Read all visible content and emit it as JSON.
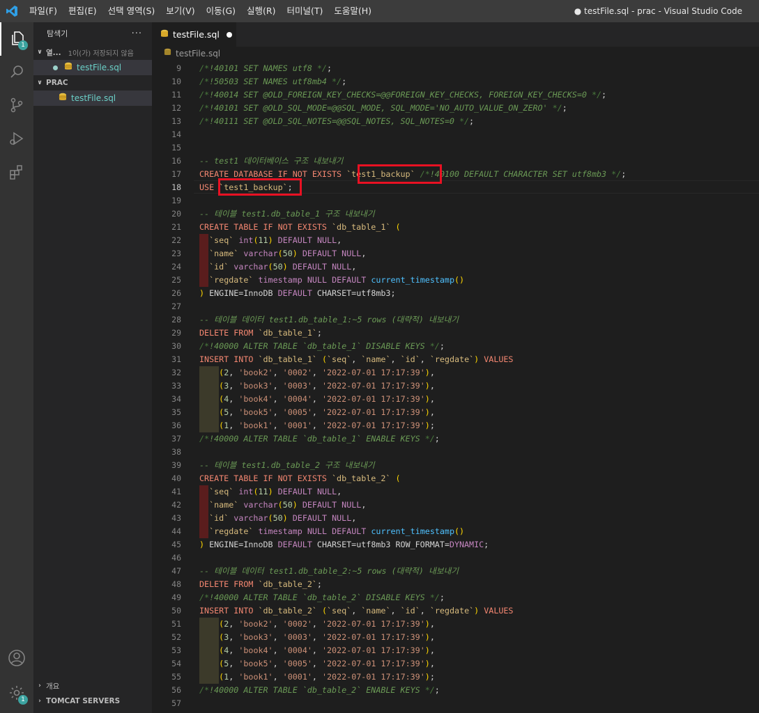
{
  "titlebar": {
    "menus": [
      "파일(F)",
      "편집(E)",
      "선택 영역(S)",
      "보기(V)",
      "이동(G)",
      "실행(R)",
      "터미널(T)",
      "도움말(H)"
    ],
    "window_title": "● testFile.sql - prac - Visual Studio Code"
  },
  "activity": {
    "explorer_badge": "1",
    "settings_badge": "1"
  },
  "sidebar": {
    "title": "탐색기",
    "more": "···",
    "open_editors": {
      "label": "열...",
      "note": "1이(가) 저장되지 않음",
      "file": "testFile.sql"
    },
    "workspace": {
      "label": "PRAC",
      "file": "testFile.sql"
    },
    "outline": "개요",
    "tomcat": "TOMCAT SERVERS"
  },
  "tab": {
    "label": "testFile.sql"
  },
  "breadcrumb": {
    "file": "testFile.sql"
  },
  "editor": {
    "current_line": 18,
    "lines": [
      {
        "n": 9,
        "html": "<span class='cmq'>/*</span><span class='cm'>!40101 SET NAMES utf8 </span><span class='cmq'>*/</span><span class='pu'>;</span>"
      },
      {
        "n": 10,
        "html": "<span class='cmq'>/*</span><span class='cm'>!50503 SET NAMES utf8mb4 </span><span class='cmq'>*/</span><span class='pu'>;</span>"
      },
      {
        "n": 11,
        "html": "<span class='cmq'>/*</span><span class='cm'>!40014 SET @OLD_FOREIGN_KEY_CHECKS=@@FOREIGN_KEY_CHECKS, FOREIGN_KEY_CHECKS=0 </span><span class='cmq'>*/</span><span class='pu'>;</span>"
      },
      {
        "n": 12,
        "html": "<span class='cmq'>/*</span><span class='cm'>!40101 SET @OLD_SQL_MODE=@@SQL_MODE, SQL_MODE='NO_AUTO_VALUE_ON_ZERO' </span><span class='cmq'>*/</span><span class='pu'>;</span>"
      },
      {
        "n": 13,
        "html": "<span class='cmq'>/*</span><span class='cm'>!40111 SET @OLD_SQL_NOTES=@@SQL_NOTES, SQL_NOTES=0 </span><span class='cmq'>*/</span><span class='pu'>;</span>"
      },
      {
        "n": 14,
        "html": ""
      },
      {
        "n": 15,
        "html": ""
      },
      {
        "n": 16,
        "html": "<span class='cm'>-- test1 데이터베이스 구조 내보내기</span>"
      },
      {
        "n": 17,
        "html": "<span class='kw'>CREATE DATABASE IF NOT EXISTS </span><span class='bt'>`test1_backup`</span><span class='pu'> </span><span class='cmq'>/*</span><span class='cm'>!40100 DEFAULT CHARACTER SET utf8mb3 </span><span class='cmq'>*/</span><span class='pu'>;</span>"
      },
      {
        "n": 18,
        "html": "<span class='kw'>USE </span><span class='bt'>`test1_backup`</span><span class='pu'>;</span>"
      },
      {
        "n": 19,
        "html": ""
      },
      {
        "n": 20,
        "html": "<span class='cm'>-- 테이블 test1.db_table_1 구조 내보내기</span>"
      },
      {
        "n": 21,
        "html": "<span class='kw'>CREATE TABLE IF NOT EXISTS </span><span class='bt'>`db_table_1`</span><span class='pu'> </span><span class='br'>(</span>"
      },
      {
        "n": 22,
        "html": "  <span class='bt'>`seq`</span> <span class='tp'>int</span><span class='br'>(</span><span class='nu'>11</span><span class='br'>)</span> <span class='kw2'>DEFAULT</span> <span class='kw2'>NULL</span><span class='pu'>,</span>"
      },
      {
        "n": 23,
        "html": "  <span class='bt'>`name`</span> <span class='tp'>varchar</span><span class='br'>(</span><span class='nu'>50</span><span class='br'>)</span> <span class='kw2'>DEFAULT</span> <span class='kw2'>NULL</span><span class='pu'>,</span>"
      },
      {
        "n": 24,
        "html": "  <span class='bt'>`id`</span> <span class='tp'>varchar</span><span class='br'>(</span><span class='nu'>50</span><span class='br'>)</span> <span class='kw2'>DEFAULT</span> <span class='kw2'>NULL</span><span class='pu'>,</span>"
      },
      {
        "n": 25,
        "html": "  <span class='bt'>`regdate`</span> <span class='tp'>timestamp</span> <span class='kw2'>NULL</span> <span class='kw2'>DEFAULT</span> <span class='fn'>current_timestamp</span><span class='br'>()</span>"
      },
      {
        "n": 26,
        "html": "<span class='br'>)</span><span class='pu'> ENGINE=InnoDB </span><span class='kw2'>DEFAULT</span><span class='pu'> CHARSET=utf8mb3;</span>"
      },
      {
        "n": 27,
        "html": ""
      },
      {
        "n": 28,
        "html": "<span class='cm'>-- 테이블 데이터 test1.db_table_1:~5 rows (대략적) 내보내기</span>"
      },
      {
        "n": 29,
        "html": "<span class='kw'>DELETE FROM </span><span class='bt'>`db_table_1`</span><span class='pu'>;</span>"
      },
      {
        "n": 30,
        "html": "<span class='cmq'>/*</span><span class='cm'>!40000 ALTER TABLE `db_table_1` DISABLE KEYS </span><span class='cmq'>*/</span><span class='pu'>;</span>"
      },
      {
        "n": 31,
        "html": "<span class='kw'>INSERT INTO </span><span class='bt'>`db_table_1`</span> <span class='br'>(</span><span class='bt'>`seq`</span><span class='pu'>, </span><span class='bt'>`name`</span><span class='pu'>, </span><span class='bt'>`id`</span><span class='pu'>, </span><span class='bt'>`regdate`</span><span class='br'>)</span><span class='kw'> VALUES</span>"
      },
      {
        "n": 32,
        "html": "    <span class='br'>(</span><span class='nu'>2</span><span class='pu'>, </span><span class='st'>'book2'</span><span class='pu'>, </span><span class='st'>'0002'</span><span class='pu'>, </span><span class='st'>'2022-07-01 17:17:39'</span><span class='br'>)</span><span class='pu'>,</span>"
      },
      {
        "n": 33,
        "html": "    <span class='br'>(</span><span class='nu'>3</span><span class='pu'>, </span><span class='st'>'book3'</span><span class='pu'>, </span><span class='st'>'0003'</span><span class='pu'>, </span><span class='st'>'2022-07-01 17:17:39'</span><span class='br'>)</span><span class='pu'>,</span>"
      },
      {
        "n": 34,
        "html": "    <span class='br'>(</span><span class='nu'>4</span><span class='pu'>, </span><span class='st'>'book4'</span><span class='pu'>, </span><span class='st'>'0004'</span><span class='pu'>, </span><span class='st'>'2022-07-01 17:17:39'</span><span class='br'>)</span><span class='pu'>,</span>"
      },
      {
        "n": 35,
        "html": "    <span class='br'>(</span><span class='nu'>5</span><span class='pu'>, </span><span class='st'>'book5'</span><span class='pu'>, </span><span class='st'>'0005'</span><span class='pu'>, </span><span class='st'>'2022-07-01 17:17:39'</span><span class='br'>)</span><span class='pu'>,</span>"
      },
      {
        "n": 36,
        "html": "    <span class='br'>(</span><span class='nu'>1</span><span class='pu'>, </span><span class='st'>'book1'</span><span class='pu'>, </span><span class='st'>'0001'</span><span class='pu'>, </span><span class='st'>'2022-07-01 17:17:39'</span><span class='br'>)</span><span class='pu'>;</span>"
      },
      {
        "n": 37,
        "html": "<span class='cmq'>/*</span><span class='cm'>!40000 ALTER TABLE `db_table_1` ENABLE KEYS </span><span class='cmq'>*/</span><span class='pu'>;</span>"
      },
      {
        "n": 38,
        "html": ""
      },
      {
        "n": 39,
        "html": "<span class='cm'>-- 테이블 test1.db_table_2 구조 내보내기</span>"
      },
      {
        "n": 40,
        "html": "<span class='kw'>CREATE TABLE IF NOT EXISTS </span><span class='bt'>`db_table_2`</span><span class='pu'> </span><span class='br'>(</span>"
      },
      {
        "n": 41,
        "html": "  <span class='bt'>`seq`</span> <span class='tp'>int</span><span class='br'>(</span><span class='nu'>11</span><span class='br'>)</span> <span class='kw2'>DEFAULT</span> <span class='kw2'>NULL</span><span class='pu'>,</span>"
      },
      {
        "n": 42,
        "html": "  <span class='bt'>`name`</span> <span class='tp'>varchar</span><span class='br'>(</span><span class='nu'>50</span><span class='br'>)</span> <span class='kw2'>DEFAULT</span> <span class='kw2'>NULL</span><span class='pu'>,</span>"
      },
      {
        "n": 43,
        "html": "  <span class='bt'>`id`</span> <span class='tp'>varchar</span><span class='br'>(</span><span class='nu'>50</span><span class='br'>)</span> <span class='kw2'>DEFAULT</span> <span class='kw2'>NULL</span><span class='pu'>,</span>"
      },
      {
        "n": 44,
        "html": "  <span class='bt'>`regdate`</span> <span class='tp'>timestamp</span> <span class='kw2'>NULL</span> <span class='kw2'>DEFAULT</span> <span class='fn'>current_timestamp</span><span class='br'>()</span>"
      },
      {
        "n": 45,
        "html": "<span class='br'>)</span><span class='pu'> ENGINE=InnoDB </span><span class='kw2'>DEFAULT</span><span class='pu'> CHARSET=utf8mb3 ROW_FORMAT=</span><span class='kw2'>DYNAMIC</span><span class='pu'>;</span>"
      },
      {
        "n": 46,
        "html": ""
      },
      {
        "n": 47,
        "html": "<span class='cm'>-- 테이블 데이터 test1.db_table_2:~5 rows (대략적) 내보내기</span>"
      },
      {
        "n": 48,
        "html": "<span class='kw'>DELETE FROM </span><span class='bt'>`db_table_2`</span><span class='pu'>;</span>"
      },
      {
        "n": 49,
        "html": "<span class='cmq'>/*</span><span class='cm'>!40000 ALTER TABLE `db_table_2` DISABLE KEYS </span><span class='cmq'>*/</span><span class='pu'>;</span>"
      },
      {
        "n": 50,
        "html": "<span class='kw'>INSERT INTO </span><span class='bt'>`db_table_2`</span> <span class='br'>(</span><span class='bt'>`seq`</span><span class='pu'>, </span><span class='bt'>`name`</span><span class='pu'>, </span><span class='bt'>`id`</span><span class='pu'>, </span><span class='bt'>`regdate`</span><span class='br'>)</span><span class='kw'> VALUES</span>"
      },
      {
        "n": 51,
        "html": "    <span class='br'>(</span><span class='nu'>2</span><span class='pu'>, </span><span class='st'>'book2'</span><span class='pu'>, </span><span class='st'>'0002'</span><span class='pu'>, </span><span class='st'>'2022-07-01 17:17:39'</span><span class='br'>)</span><span class='pu'>,</span>"
      },
      {
        "n": 52,
        "html": "    <span class='br'>(</span><span class='nu'>3</span><span class='pu'>, </span><span class='st'>'book3'</span><span class='pu'>, </span><span class='st'>'0003'</span><span class='pu'>, </span><span class='st'>'2022-07-01 17:17:39'</span><span class='br'>)</span><span class='pu'>,</span>"
      },
      {
        "n": 53,
        "html": "    <span class='br'>(</span><span class='nu'>4</span><span class='pu'>, </span><span class='st'>'book4'</span><span class='pu'>, </span><span class='st'>'0004'</span><span class='pu'>, </span><span class='st'>'2022-07-01 17:17:39'</span><span class='br'>)</span><span class='pu'>,</span>"
      },
      {
        "n": 54,
        "html": "    <span class='br'>(</span><span class='nu'>5</span><span class='pu'>, </span><span class='st'>'book5'</span><span class='pu'>, </span><span class='st'>'0005'</span><span class='pu'>, </span><span class='st'>'2022-07-01 17:17:39'</span><span class='br'>)</span><span class='pu'>,</span>"
      },
      {
        "n": 55,
        "html": "    <span class='br'>(</span><span class='nu'>1</span><span class='pu'>, </span><span class='st'>'book1'</span><span class='pu'>, </span><span class='st'>'0001'</span><span class='pu'>, </span><span class='st'>'2022-07-01 17:17:39'</span><span class='br'>)</span><span class='pu'>;</span>"
      },
      {
        "n": 56,
        "html": "<span class='cmq'>/*</span><span class='cm'>!40000 ALTER TABLE `db_table_2` ENABLE KEYS </span><span class='cmq'>*/</span><span class='pu'>;</span>"
      },
      {
        "n": 57,
        "html": ""
      }
    ]
  }
}
